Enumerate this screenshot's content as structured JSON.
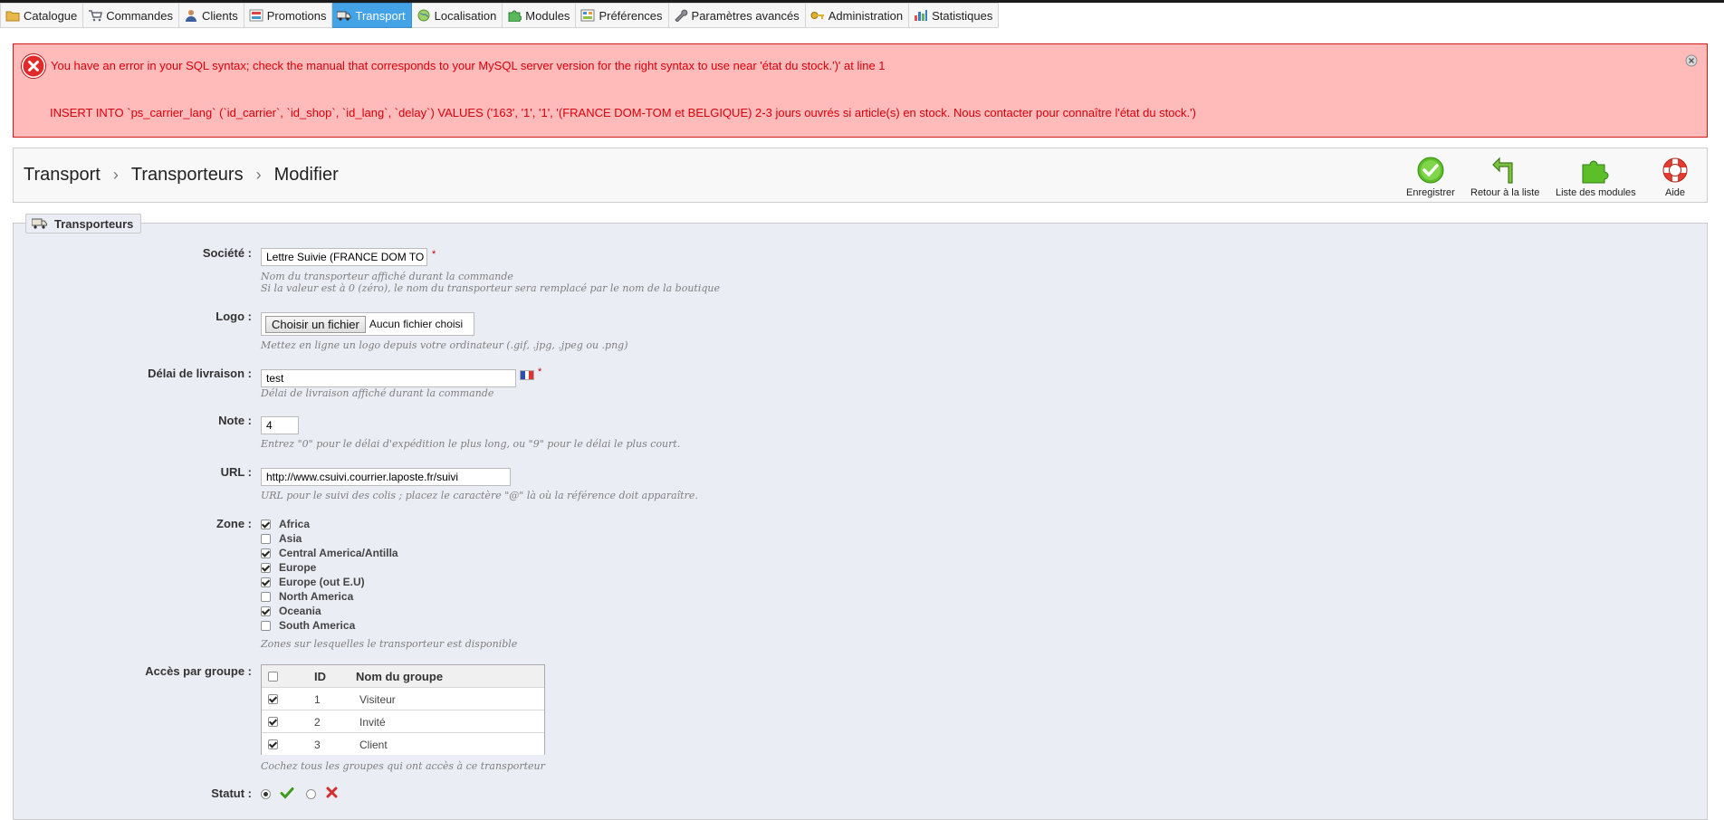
{
  "nav": [
    {
      "label": "Catalogue",
      "icon": "folder-icon",
      "active": false
    },
    {
      "label": "Commandes",
      "icon": "cart-icon",
      "active": false
    },
    {
      "label": "Clients",
      "icon": "user-icon",
      "active": false
    },
    {
      "label": "Promotions",
      "icon": "promotions-icon",
      "active": false
    },
    {
      "label": "Transport",
      "icon": "truck-icon",
      "active": true
    },
    {
      "label": "Localisation",
      "icon": "globe-icon",
      "active": false
    },
    {
      "label": "Modules",
      "icon": "puzzle-icon",
      "active": false
    },
    {
      "label": "Préférences",
      "icon": "preferences-icon",
      "active": false
    },
    {
      "label": "Paramètres avancés",
      "icon": "wrench-icon",
      "active": false
    },
    {
      "label": "Administration",
      "icon": "key-icon",
      "active": false
    },
    {
      "label": "Statistiques",
      "icon": "stats-icon",
      "active": false
    }
  ],
  "error": {
    "message": "You have an error in your SQL syntax; check the manual that corresponds to your MySQL server version for the right syntax to use near 'état du stock.')' at line 1",
    "query": "INSERT INTO `ps_carrier_lang` (`id_carrier`, `id_shop`, `id_lang`, `delay`) VALUES ('163', '1', '1', '(FRANCE DOM-TOM et BELGIQUE) 2-3 jours ouvrés si article(s) en stock. Nous contacter pour connaître l'état du stock.')"
  },
  "breadcrumb": [
    "Transport",
    "Transporteurs",
    "Modifier"
  ],
  "toolbar": {
    "save": "Enregistrer",
    "back": "Retour à la liste",
    "modules": "Liste des modules",
    "help": "Aide"
  },
  "form": {
    "legend": "Transporteurs",
    "company": {
      "label": "Société :",
      "value": "Lettre Suivie (FRANCE DOM TO",
      "hint1": "Nom du transporteur affiché durant la commande",
      "hint2": "Si la valeur est à 0 (zéro), le nom du transporteur sera remplacé par le nom de la boutique"
    },
    "logo": {
      "label": "Logo :",
      "button": "Choisir un fichier",
      "file": "Aucun fichier choisi",
      "hint": "Mettez en ligne un logo depuis votre ordinateur (.gif, .jpg, .jpeg ou .png)"
    },
    "delay": {
      "label": "Délai de livraison :",
      "value": "test",
      "hint": "Délai de livraison affiché durant la commande"
    },
    "grade": {
      "label": "Note :",
      "value": "4",
      "hint": "Entrez \"0\" pour le délai d'expédition le plus long, ou \"9\" pour le délai le plus court."
    },
    "url": {
      "label": "URL :",
      "value": "http://www.csuivi.courrier.laposte.fr/suivi",
      "hint": "URL pour le suivi des colis ; placez le caractère \"@\" là où la référence doit apparaître."
    },
    "zone": {
      "label": "Zone :",
      "items": [
        {
          "name": "Africa",
          "checked": true
        },
        {
          "name": "Asia",
          "checked": false
        },
        {
          "name": "Central America/Antilla",
          "checked": true
        },
        {
          "name": "Europe",
          "checked": true
        },
        {
          "name": "Europe (out E.U)",
          "checked": true
        },
        {
          "name": "North America",
          "checked": false
        },
        {
          "name": "Oceania",
          "checked": true
        },
        {
          "name": "South America",
          "checked": false
        }
      ],
      "hint": "Zones sur lesquelles le transporteur est disponible"
    },
    "groups": {
      "label": "Accès par groupe :",
      "col_id": "ID",
      "col_name": "Nom du groupe",
      "rows": [
        {
          "id": "1",
          "name": "Visiteur",
          "checked": true
        },
        {
          "id": "2",
          "name": "Invité",
          "checked": true
        },
        {
          "id": "3",
          "name": "Client",
          "checked": true
        }
      ],
      "hint": "Cochez tous les groupes qui ont accès à ce transporteur"
    },
    "status": {
      "label": "Statut :",
      "enabled": true
    }
  }
}
